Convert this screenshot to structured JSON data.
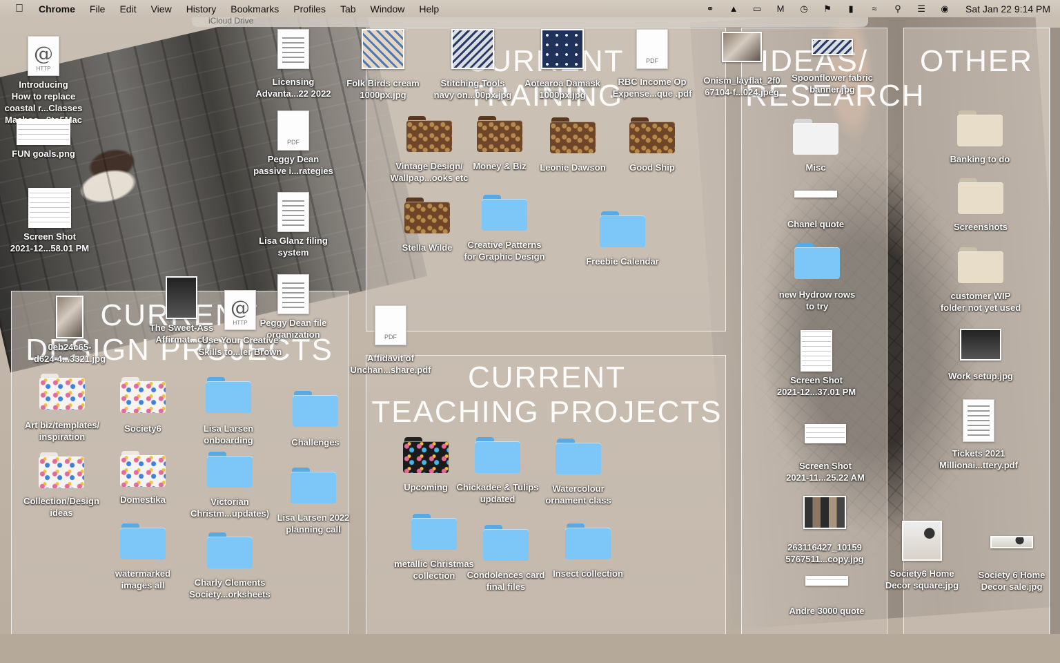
{
  "menubar": {
    "apple": "",
    "app_name": "Chrome",
    "items": [
      "File",
      "Edit",
      "View",
      "History",
      "Bookmarks",
      "Profiles",
      "Tab",
      "Window",
      "Help"
    ],
    "clock": "Sat Jan 22  9:14 PM"
  },
  "sections": {
    "current_training": "CURRENT\nTRAINING",
    "ideas_research": "IDEAS/\nRESEARCH",
    "other": "OTHER",
    "current_design_projects": "CURRENT\nDESIGN PROJECTS",
    "current_teaching_projects": "CURRENT\nTEACHING PROJECTS"
  },
  "icloud_label": "iCloud Drive",
  "desktop_items": {
    "introducing": "Introducing\nHow to replace\ncoastal r...Classes\nMacboo...9to5Mac",
    "fun_goals": "FUN goals.png",
    "screenshot_58": "Screen Shot\n2021-12...58.01 PM",
    "licensing": "Licensing\nAdvanta...22 2022",
    "peggy_passive": "Peggy Dean\npassive i...rategies",
    "lisa_filing": "Lisa Glanz filing\nsystem",
    "peggy_file": "Peggy Dean file\norganization",
    "sweet_ass": "The Sweet-Ass\nAffirmat...ck",
    "use_creative": "Use Your Creative\nSkills to...ler Brown",
    "oeb24": "0eb24c65-\nd624-4...3321.jpg",
    "folk_birds": "Folk Birds cream\n1000px.jpg",
    "stitching": "Stitching Tools\nnavy on...00px.jpg",
    "aotearoa": "Aotearoa Damask\n1000px.jpg",
    "rbc": "RBC Income Op\nExpense...que .pdf",
    "onism": "Onism_layflat_2f0\n67104-f...024.jpeg",
    "spoonflower": "Spoonflower fabric\nbanner.jpg",
    "vintage": "Vintage Design/\nWallpap...ooks etc",
    "money_biz": "Money & Biz",
    "leonie": "Leonie Dawson",
    "good_ship": "Good Ship",
    "stella": "Stella Wilde",
    "creative_patterns": "Creative Patterns\nfor Graphic Design",
    "freebie": "Freebie Calendar",
    "affidavit": "Affidavit of\nUnchan...share.pdf",
    "misc": "Misc",
    "chanel": "Chanel quote",
    "hydrow": "new Hydrow rows\nto try",
    "screenshot_37": "Screen Shot\n2021-12...37.01 PM",
    "screenshot_25": "Screen Shot\n2021-11...25.22 AM",
    "img_263": "263116427_10159\n5767511...copy.jpg",
    "andre": "Andre 3000 quote",
    "banking": "Banking to do",
    "screenshots": "Screenshots",
    "customer_wip": "customer WIP\nfolder not yet used",
    "work_setup": "Work setup.jpg",
    "tickets": "Tickets 2021\nMillionai...ttery.pdf",
    "society6_square": "Society6 Home\nDecor square.jpg",
    "society6_sale": "Society 6 Home\nDecor sale.jpg",
    "art_biz": "Art biz/templates/\ninspiration",
    "society6": "Society6",
    "lisa_onboarding": "Lisa Larsen\nonboarding",
    "challenges": "Challenges",
    "collection": "Collection/Design\nideas",
    "domestika": "Domestika",
    "victorian": "Victorian\nChristm...updates)",
    "lisa_2022": "Lisa Larsen 2022\nplanning call",
    "watermarked": "watermarked\nimages  all",
    "charly": "Charly Clements\nSociety...orksheets",
    "upcoming": "Upcoming",
    "chickadee": "Chickadee & Tulips\nupdated",
    "watercolour": "Watercolour\nornament class",
    "metallic": "metallic Christmas\ncollection",
    "condolences": "Condolences card\nfinal files",
    "insect": "Insect collection"
  }
}
